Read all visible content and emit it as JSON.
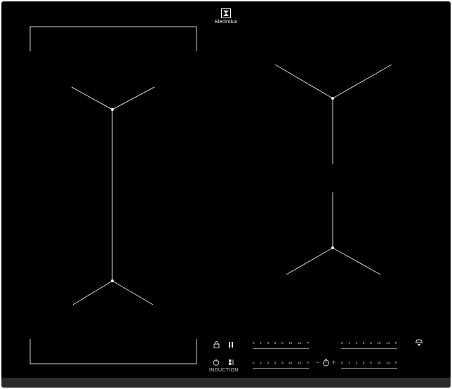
{
  "brand": {
    "name": "Electrolux",
    "logo_icon": "electrolux-logo-icon"
  },
  "control_panel": {
    "induction_label": "INDUCTION",
    "lock_icon": "lock-icon",
    "pause_icon": "pause-icon",
    "power_icon": "power-icon",
    "bridge_icon": "bridge-icon",
    "hob2hood_icon": "hood-fan-icon",
    "timer": {
      "minus_label": "−",
      "plus_label": "+",
      "icon": "timer-icon"
    },
    "sliders": [
      {
        "ticks": [
          "0",
          "1",
          "3",
          "5",
          "8",
          "10",
          "14",
          "P"
        ]
      },
      {
        "ticks": [
          "0",
          "1",
          "3",
          "5",
          "8",
          "10",
          "14",
          "P"
        ]
      },
      {
        "ticks": [
          "0",
          "1",
          "3",
          "5",
          "8",
          "10",
          "14",
          "P"
        ]
      },
      {
        "ticks": [
          "0",
          "1",
          "3",
          "5",
          "8",
          "10",
          "14",
          "P"
        ]
      }
    ]
  },
  "colors": {
    "glass": "#000000",
    "markings": "#d9d9d9",
    "frame": "#2b2b2b"
  }
}
